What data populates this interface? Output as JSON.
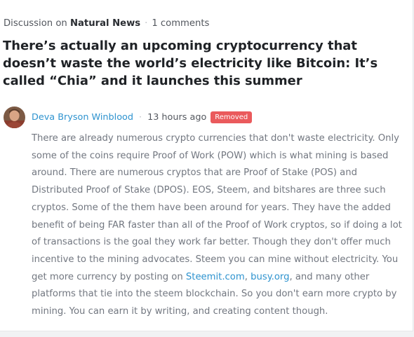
{
  "post": {
    "discussion_prefix": "Discussion on",
    "community": "Natural News",
    "comments_count": "1 comments",
    "title": "There’s actually an upcoming cryptocurrency that doesn’t waste the world’s electricity like Bitcoin: It’s called “Chia” and it launches this summer"
  },
  "comment": {
    "author": "Deva Bryson Winblood",
    "time": "13 hours ago",
    "badge": "Removed",
    "badge_color": "#ea5a5c",
    "avatar_icon": "user-avatar",
    "body_part1": "There are already numerous crypto currencies that don't waste electricity. Only some of the coins require Proof of Work (POW) which is what mining is based around. There are numerous cryptos that are Proof of Stake (POS) and Distributed Proof of Stake (DPOS). EOS, Steem, and bitshares are three such cryptos. Some of the them have been around for years. They have the added benefit of being FAR faster than all of the Proof of Work cryptos, so if doing a lot of transactions is the goal they work far better. Though they don't offer much incentive to the mining advocates. Steem you can mine without electricity. You get more currency by posting on ",
    "link1": "Steemit.com",
    "body_part2": ", ",
    "link2": "busy.org",
    "body_part3": ", and many other platforms that tie into the steem blockchain. So you don't earn more crypto by mining. You can earn it by writing, and creating content though."
  },
  "colors": {
    "link": "#2e93cf",
    "text_muted": "#727780",
    "title": "#1f2226"
  }
}
